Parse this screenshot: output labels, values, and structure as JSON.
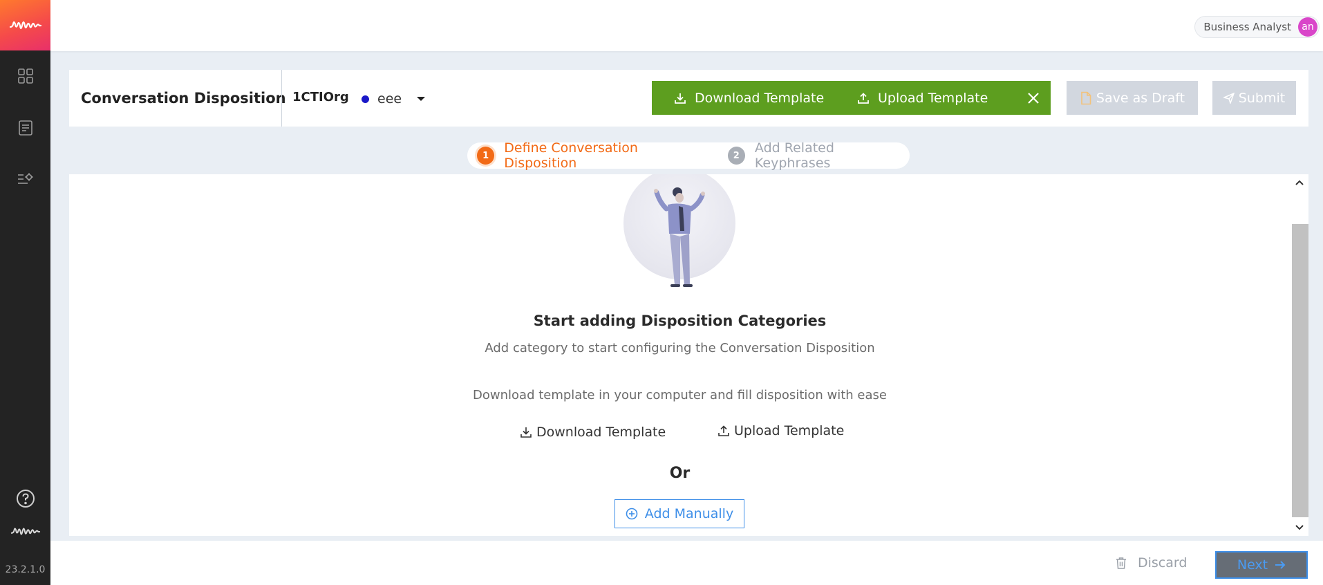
{
  "app": {
    "version": "23.2.1.0"
  },
  "topbar": {
    "user_role": "Business Analyst",
    "avatar_initials": "an"
  },
  "header": {
    "title": "Conversation Disposition",
    "org": "1CTIOrg",
    "environment": "eee",
    "environment_dot_color": "#1a18c8",
    "download_template": "Download Template",
    "upload_template": "Upload Template",
    "save_as_draft": "Save as Draft",
    "submit": "Submit"
  },
  "stepper": {
    "steps": [
      {
        "number": "1",
        "label": "Define Conversation Disposition",
        "state": "active"
      },
      {
        "number": "2",
        "label": "Add Related Keyphrases",
        "state": "inactive"
      }
    ]
  },
  "empty_state": {
    "title": "Start adding Disposition Categories",
    "subtitle": "Add category to start configuring the Conversation Disposition",
    "template_hint": "Download template in your computer and fill disposition with ease",
    "download_template": "Download Template",
    "upload_template": "Upload Template",
    "or": "Or",
    "add_manually": "Add Manually"
  },
  "footer": {
    "discard": "Discard",
    "next": "Next"
  },
  "colors": {
    "accent_orange": "#f26a16",
    "action_green": "#5d9e1f",
    "link_blue": "#3f8fe8",
    "disabled_gray": "#d2d7df",
    "rail_dark": "#232323"
  }
}
